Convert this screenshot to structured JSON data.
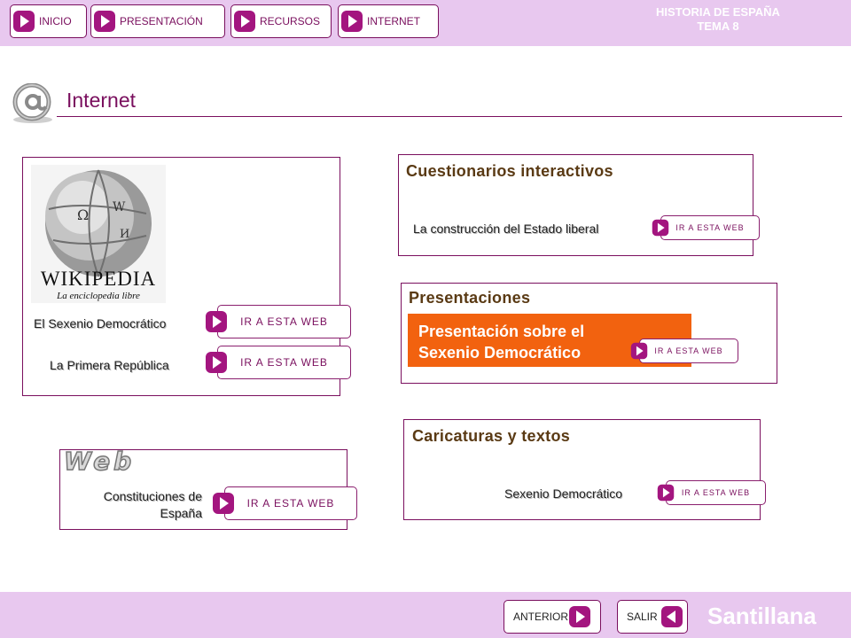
{
  "header": {
    "nav": [
      {
        "label": "INICIO"
      },
      {
        "label": "PRESENTACIÓN"
      },
      {
        "label": "RECURSOS"
      },
      {
        "label": "INTERNET"
      }
    ],
    "course_line1": "HISTORIA DE ESPAÑA",
    "course_line2": "TEMA 8"
  },
  "page": {
    "title": "Internet"
  },
  "wikipedia": {
    "logo_text": "WIKIPEDIA",
    "logo_tagline": "La enciclopedia libre",
    "links": [
      {
        "label": "El Sexenio Democrático",
        "button": "IR A ESTA WEB"
      },
      {
        "label": "La Primera República",
        "button": "IR A ESTA WEB"
      }
    ]
  },
  "cuestionarios": {
    "heading": "Cuestionarios interactivos",
    "link": {
      "label": "La construcción del Estado liberal",
      "button": "IR A ESTA WEB"
    }
  },
  "presentaciones": {
    "heading": "Presentaciones",
    "highlight_line1": "Presentación sobre el",
    "highlight_line2": "Sexenio Democrático",
    "button": "IR A ESTA WEB"
  },
  "caricaturas": {
    "heading": "Caricaturas y textos",
    "link": {
      "label": "Sexenio Democrático",
      "button": "IR A ESTA WEB"
    }
  },
  "web": {
    "logo_text": "Web",
    "link_line1": "Constituciones de",
    "link_line2": "España",
    "button": "IR A ESTA WEB"
  },
  "footer": {
    "prev_label": "ANTERIOR",
    "exit_label": "SALIR",
    "brand": "Santillana"
  },
  "colors": {
    "bar": "#e8c8ef",
    "accent": "#7a0f5e",
    "play": "#a3157f",
    "highlight": "#f2620f"
  }
}
